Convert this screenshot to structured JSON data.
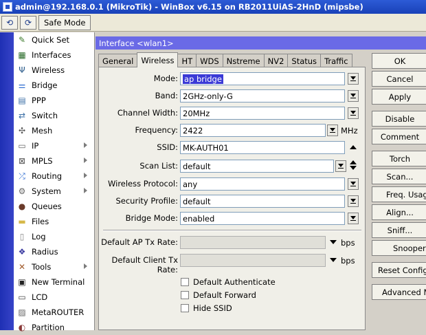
{
  "app": {
    "title": "admin@192.168.0.1 (MikroTik) - WinBox v6.15 on RB2011UiAS-2HnD (mipsbe)"
  },
  "toolbar": {
    "safe_mode_label": "Safe Mode"
  },
  "sidebar": {
    "items": [
      {
        "label": "Quick Set",
        "icon": "quick-set-icon",
        "arrow": false
      },
      {
        "label": "Interfaces",
        "icon": "interfaces-icon",
        "arrow": false
      },
      {
        "label": "Wireless",
        "icon": "wireless-icon",
        "arrow": false
      },
      {
        "label": "Bridge",
        "icon": "bridge-icon",
        "arrow": false
      },
      {
        "label": "PPP",
        "icon": "ppp-icon",
        "arrow": false
      },
      {
        "label": "Switch",
        "icon": "switch-icon",
        "arrow": false
      },
      {
        "label": "Mesh",
        "icon": "mesh-icon",
        "arrow": false
      },
      {
        "label": "IP",
        "icon": "ip-icon",
        "arrow": true
      },
      {
        "label": "MPLS",
        "icon": "mpls-icon",
        "arrow": true
      },
      {
        "label": "Routing",
        "icon": "routing-icon",
        "arrow": true
      },
      {
        "label": "System",
        "icon": "system-icon",
        "arrow": true
      },
      {
        "label": "Queues",
        "icon": "queues-icon",
        "arrow": false
      },
      {
        "label": "Files",
        "icon": "files-icon",
        "arrow": false
      },
      {
        "label": "Log",
        "icon": "log-icon",
        "arrow": false
      },
      {
        "label": "Radius",
        "icon": "radius-icon",
        "arrow": false
      },
      {
        "label": "Tools",
        "icon": "tools-icon",
        "arrow": true
      },
      {
        "label": "New Terminal",
        "icon": "terminal-icon",
        "arrow": false
      },
      {
        "label": "LCD",
        "icon": "lcd-icon",
        "arrow": false
      },
      {
        "label": "MetaROUTER",
        "icon": "metarouter-icon",
        "arrow": false
      },
      {
        "label": "Partition",
        "icon": "partition-icon",
        "arrow": false
      }
    ]
  },
  "window": {
    "title": "Interface <wlan1>"
  },
  "tabs": [
    "General",
    "Wireless",
    "HT",
    "WDS",
    "Nstreme",
    "NV2",
    "Status",
    "Traffic"
  ],
  "form": {
    "mode": {
      "label": "Mode:",
      "value": "ap bridge"
    },
    "band": {
      "label": "Band:",
      "value": "2GHz-only-G"
    },
    "channel_width": {
      "label": "Channel Width:",
      "value": "20MHz"
    },
    "frequency": {
      "label": "Frequency:",
      "value": "2422",
      "unit": "MHz"
    },
    "ssid": {
      "label": "SSID:",
      "value": "MK-AUTH01"
    },
    "scan_list": {
      "label": "Scan List:",
      "value": "default"
    },
    "wireless_protocol": {
      "label": "Wireless Protocol:",
      "value": "any"
    },
    "security_profile": {
      "label": "Security Profile:",
      "value": "default"
    },
    "bridge_mode": {
      "label": "Bridge Mode:",
      "value": "enabled"
    },
    "default_ap_tx_rate": {
      "label": "Default AP Tx Rate:",
      "value": "",
      "unit": "bps"
    },
    "default_client_tx_rate": {
      "label": "Default Client Tx Rate:",
      "value": "",
      "unit": "bps"
    },
    "checkboxes": [
      {
        "label": "Default Authenticate",
        "checked": false
      },
      {
        "label": "Default Forward",
        "checked": false
      },
      {
        "label": "Hide SSID",
        "checked": false
      }
    ]
  },
  "buttons": [
    "OK",
    "Cancel",
    "Apply",
    "Disable",
    "Comment",
    "Torch",
    "Scan...",
    "Freq. Usage",
    "Align...",
    "Sniff...",
    "Snooper...",
    "Reset Configuration",
    "Advanced Mode"
  ],
  "colors": {
    "title_bar": "#1941b8",
    "window_title": "#6a6ae6",
    "left_strip": "#1e2fb4",
    "selection": "#3a3ad6"
  }
}
